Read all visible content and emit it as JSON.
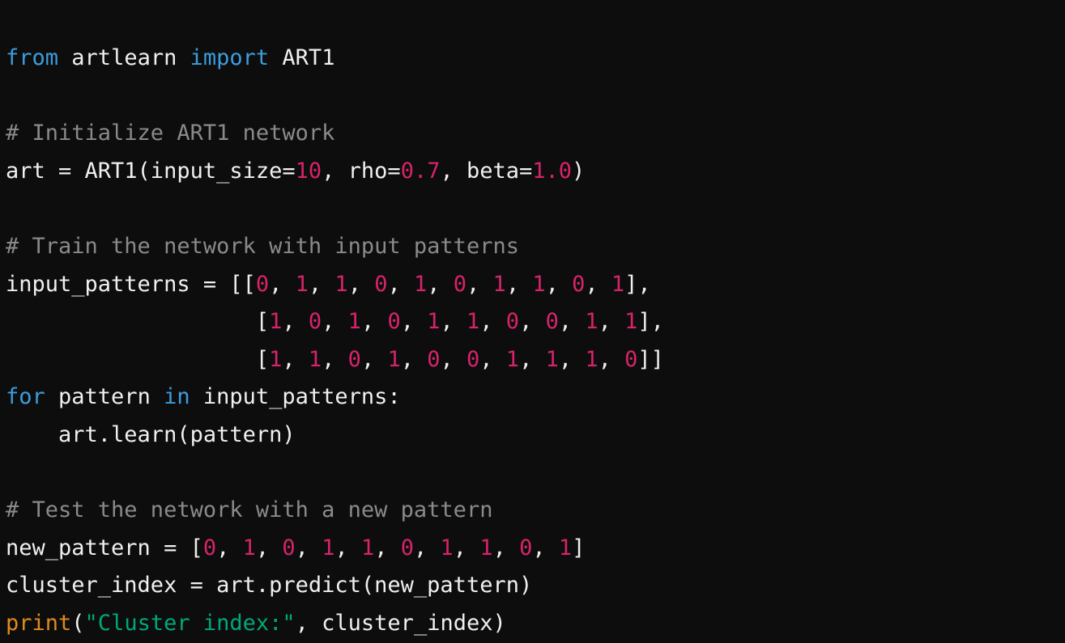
{
  "editor": {
    "language": "python",
    "background_color": "#0d0d0d",
    "theme": "dark"
  },
  "palette": {
    "keyword": "#3b9ddd",
    "comment": "#8a8a8a",
    "number": "#d6236a",
    "string": "#00a878",
    "builtin": "#e08a1e",
    "plain": "#f0f0f0"
  },
  "code": {
    "lines": [
      {
        "index": 1,
        "text": "from artlearn import ART1",
        "tokens": [
          {
            "t": "from",
            "c": "kw"
          },
          {
            "t": " ",
            "c": "plain"
          },
          {
            "t": "artlearn",
            "c": "plain"
          },
          {
            "t": " ",
            "c": "plain"
          },
          {
            "t": "import",
            "c": "kw"
          },
          {
            "t": " ",
            "c": "plain"
          },
          {
            "t": "ART1",
            "c": "plain"
          }
        ]
      },
      {
        "index": 2,
        "text": "",
        "tokens": []
      },
      {
        "index": 3,
        "text": "# Initialize ART1 network",
        "tokens": [
          {
            "t": "# Initialize ART1 network",
            "c": "comment"
          }
        ]
      },
      {
        "index": 4,
        "text": "art = ART1(input_size=10, rho=0.7, beta=1.0)",
        "tokens": [
          {
            "t": "art = ART1(input_size=",
            "c": "plain"
          },
          {
            "t": "10",
            "c": "num"
          },
          {
            "t": ", rho=",
            "c": "plain"
          },
          {
            "t": "0.7",
            "c": "num"
          },
          {
            "t": ", beta=",
            "c": "plain"
          },
          {
            "t": "1.0",
            "c": "num"
          },
          {
            "t": ")",
            "c": "plain"
          }
        ]
      },
      {
        "index": 5,
        "text": "",
        "tokens": []
      },
      {
        "index": 6,
        "text": "# Train the network with input patterns",
        "tokens": [
          {
            "t": "# Train the network with input patterns",
            "c": "comment"
          }
        ]
      },
      {
        "index": 7,
        "text": "input_patterns = [[0, 1, 1, 0, 1, 0, 1, 1, 0, 1],",
        "tokens": [
          {
            "t": "input_patterns = [[",
            "c": "plain"
          },
          {
            "t": "0",
            "c": "num"
          },
          {
            "t": ", ",
            "c": "plain"
          },
          {
            "t": "1",
            "c": "num"
          },
          {
            "t": ", ",
            "c": "plain"
          },
          {
            "t": "1",
            "c": "num"
          },
          {
            "t": ", ",
            "c": "plain"
          },
          {
            "t": "0",
            "c": "num"
          },
          {
            "t": ", ",
            "c": "plain"
          },
          {
            "t": "1",
            "c": "num"
          },
          {
            "t": ", ",
            "c": "plain"
          },
          {
            "t": "0",
            "c": "num"
          },
          {
            "t": ", ",
            "c": "plain"
          },
          {
            "t": "1",
            "c": "num"
          },
          {
            "t": ", ",
            "c": "plain"
          },
          {
            "t": "1",
            "c": "num"
          },
          {
            "t": ", ",
            "c": "plain"
          },
          {
            "t": "0",
            "c": "num"
          },
          {
            "t": ", ",
            "c": "plain"
          },
          {
            "t": "1",
            "c": "num"
          },
          {
            "t": "],",
            "c": "plain"
          }
        ]
      },
      {
        "index": 8,
        "text": "                   [1, 0, 1, 0, 1, 1, 0, 0, 1, 1],",
        "tokens": [
          {
            "t": "                   [",
            "c": "plain"
          },
          {
            "t": "1",
            "c": "num"
          },
          {
            "t": ", ",
            "c": "plain"
          },
          {
            "t": "0",
            "c": "num"
          },
          {
            "t": ", ",
            "c": "plain"
          },
          {
            "t": "1",
            "c": "num"
          },
          {
            "t": ", ",
            "c": "plain"
          },
          {
            "t": "0",
            "c": "num"
          },
          {
            "t": ", ",
            "c": "plain"
          },
          {
            "t": "1",
            "c": "num"
          },
          {
            "t": ", ",
            "c": "plain"
          },
          {
            "t": "1",
            "c": "num"
          },
          {
            "t": ", ",
            "c": "plain"
          },
          {
            "t": "0",
            "c": "num"
          },
          {
            "t": ", ",
            "c": "plain"
          },
          {
            "t": "0",
            "c": "num"
          },
          {
            "t": ", ",
            "c": "plain"
          },
          {
            "t": "1",
            "c": "num"
          },
          {
            "t": ", ",
            "c": "plain"
          },
          {
            "t": "1",
            "c": "num"
          },
          {
            "t": "],",
            "c": "plain"
          }
        ]
      },
      {
        "index": 9,
        "text": "                   [1, 1, 0, 1, 0, 0, 1, 1, 1, 0]]",
        "tokens": [
          {
            "t": "                   [",
            "c": "plain"
          },
          {
            "t": "1",
            "c": "num"
          },
          {
            "t": ", ",
            "c": "plain"
          },
          {
            "t": "1",
            "c": "num"
          },
          {
            "t": ", ",
            "c": "plain"
          },
          {
            "t": "0",
            "c": "num"
          },
          {
            "t": ", ",
            "c": "plain"
          },
          {
            "t": "1",
            "c": "num"
          },
          {
            "t": ", ",
            "c": "plain"
          },
          {
            "t": "0",
            "c": "num"
          },
          {
            "t": ", ",
            "c": "plain"
          },
          {
            "t": "0",
            "c": "num"
          },
          {
            "t": ", ",
            "c": "plain"
          },
          {
            "t": "1",
            "c": "num"
          },
          {
            "t": ", ",
            "c": "plain"
          },
          {
            "t": "1",
            "c": "num"
          },
          {
            "t": ", ",
            "c": "plain"
          },
          {
            "t": "1",
            "c": "num"
          },
          {
            "t": ", ",
            "c": "plain"
          },
          {
            "t": "0",
            "c": "num"
          },
          {
            "t": "]]",
            "c": "plain"
          }
        ]
      },
      {
        "index": 10,
        "text": "for pattern in input_patterns:",
        "tokens": [
          {
            "t": "for",
            "c": "kw"
          },
          {
            "t": " pattern ",
            "c": "plain"
          },
          {
            "t": "in",
            "c": "kw"
          },
          {
            "t": " input_patterns:",
            "c": "plain"
          }
        ]
      },
      {
        "index": 11,
        "text": "    art.learn(pattern)",
        "tokens": [
          {
            "t": "    art.learn(pattern)",
            "c": "plain"
          }
        ]
      },
      {
        "index": 12,
        "text": "",
        "tokens": []
      },
      {
        "index": 13,
        "text": "# Test the network with a new pattern",
        "tokens": [
          {
            "t": "# Test the network with a new pattern",
            "c": "comment"
          }
        ]
      },
      {
        "index": 14,
        "text": "new_pattern = [0, 1, 0, 1, 1, 0, 1, 1, 0, 1]",
        "tokens": [
          {
            "t": "new_pattern = [",
            "c": "plain"
          },
          {
            "t": "0",
            "c": "num"
          },
          {
            "t": ", ",
            "c": "plain"
          },
          {
            "t": "1",
            "c": "num"
          },
          {
            "t": ", ",
            "c": "plain"
          },
          {
            "t": "0",
            "c": "num"
          },
          {
            "t": ", ",
            "c": "plain"
          },
          {
            "t": "1",
            "c": "num"
          },
          {
            "t": ", ",
            "c": "plain"
          },
          {
            "t": "1",
            "c": "num"
          },
          {
            "t": ", ",
            "c": "plain"
          },
          {
            "t": "0",
            "c": "num"
          },
          {
            "t": ", ",
            "c": "plain"
          },
          {
            "t": "1",
            "c": "num"
          },
          {
            "t": ", ",
            "c": "plain"
          },
          {
            "t": "1",
            "c": "num"
          },
          {
            "t": ", ",
            "c": "plain"
          },
          {
            "t": "0",
            "c": "num"
          },
          {
            "t": ", ",
            "c": "plain"
          },
          {
            "t": "1",
            "c": "num"
          },
          {
            "t": "]",
            "c": "plain"
          }
        ]
      },
      {
        "index": 15,
        "text": "cluster_index = art.predict(new_pattern)",
        "tokens": [
          {
            "t": "cluster_index = art.predict(new_pattern)",
            "c": "plain"
          }
        ]
      },
      {
        "index": 16,
        "text": "print(\"Cluster index:\", cluster_index)",
        "tokens": [
          {
            "t": "print",
            "c": "builtin"
          },
          {
            "t": "(",
            "c": "plain"
          },
          {
            "t": "\"Cluster index:\"",
            "c": "str"
          },
          {
            "t": ", cluster_index)",
            "c": "plain"
          }
        ]
      }
    ]
  }
}
